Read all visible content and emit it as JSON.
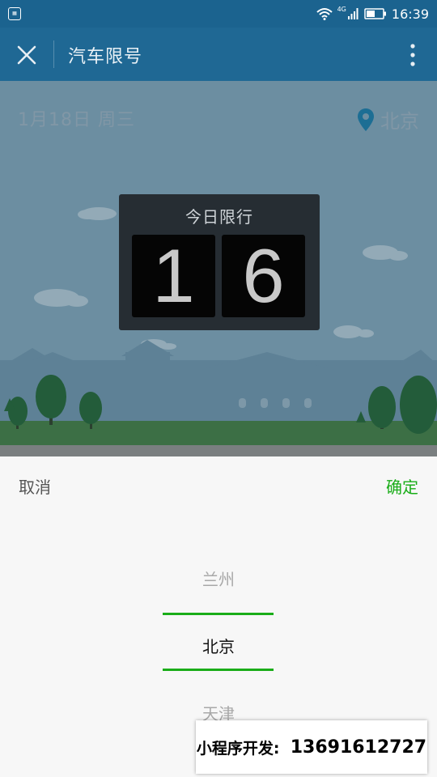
{
  "status_bar": {
    "app_icon": "calendar-app-icon",
    "net_label": "4G",
    "time": "16:39"
  },
  "titlebar": {
    "title": "汽车限号",
    "close_icon": "close-icon",
    "more_icon": "more-vertical-icon"
  },
  "hero": {
    "date": "1月18日  周三",
    "location": "北京",
    "location_icon": "location-pin-icon",
    "card_title": "今日限行",
    "digits": [
      "1",
      "6"
    ]
  },
  "sheet": {
    "cancel_label": "取消",
    "confirm_label": "确定",
    "accent_color": "#1aad19",
    "options": [
      "兰州",
      "北京",
      "天津"
    ],
    "selected_option": "北京"
  },
  "banner": {
    "label": "小程序开发:",
    "phone": "13691612727"
  }
}
